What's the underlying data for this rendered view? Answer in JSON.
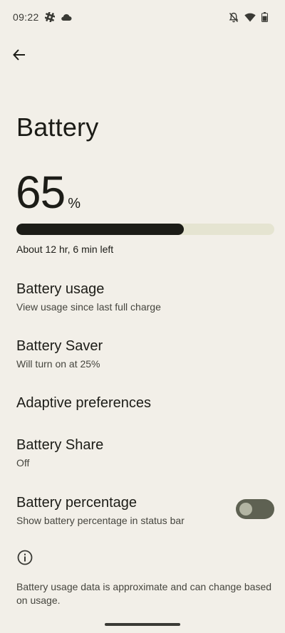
{
  "status_bar": {
    "time": "09:22"
  },
  "page": {
    "title": "Battery"
  },
  "battery": {
    "percent": "65",
    "unit": "%",
    "level_fraction": 0.65,
    "time_left": "About 12 hr, 6 min left"
  },
  "settings": [
    {
      "title": "Battery usage",
      "summary": "View usage since last full charge"
    },
    {
      "title": "Battery Saver",
      "summary": "Will turn on at 25%"
    },
    {
      "title": "Adaptive preferences"
    },
    {
      "title": "Battery Share",
      "summary": "Off"
    },
    {
      "title": "Battery percentage",
      "summary": "Show battery percentage in status bar",
      "toggle_on": false
    }
  ],
  "footer": {
    "text": "Battery usage data is approximate and can change based on usage."
  },
  "colors": {
    "background": "#f2efe8",
    "progress_fill": "#1c1c17",
    "progress_track": "#e5e4d1",
    "toggle_track": "#5e6152"
  },
  "icons": {
    "status_left": [
      "slack-icon",
      "cloud-icon"
    ],
    "status_right": [
      "notifications-off-icon",
      "wifi-icon",
      "battery-icon"
    ],
    "back": "arrow-back-icon",
    "info": "info-icon"
  }
}
